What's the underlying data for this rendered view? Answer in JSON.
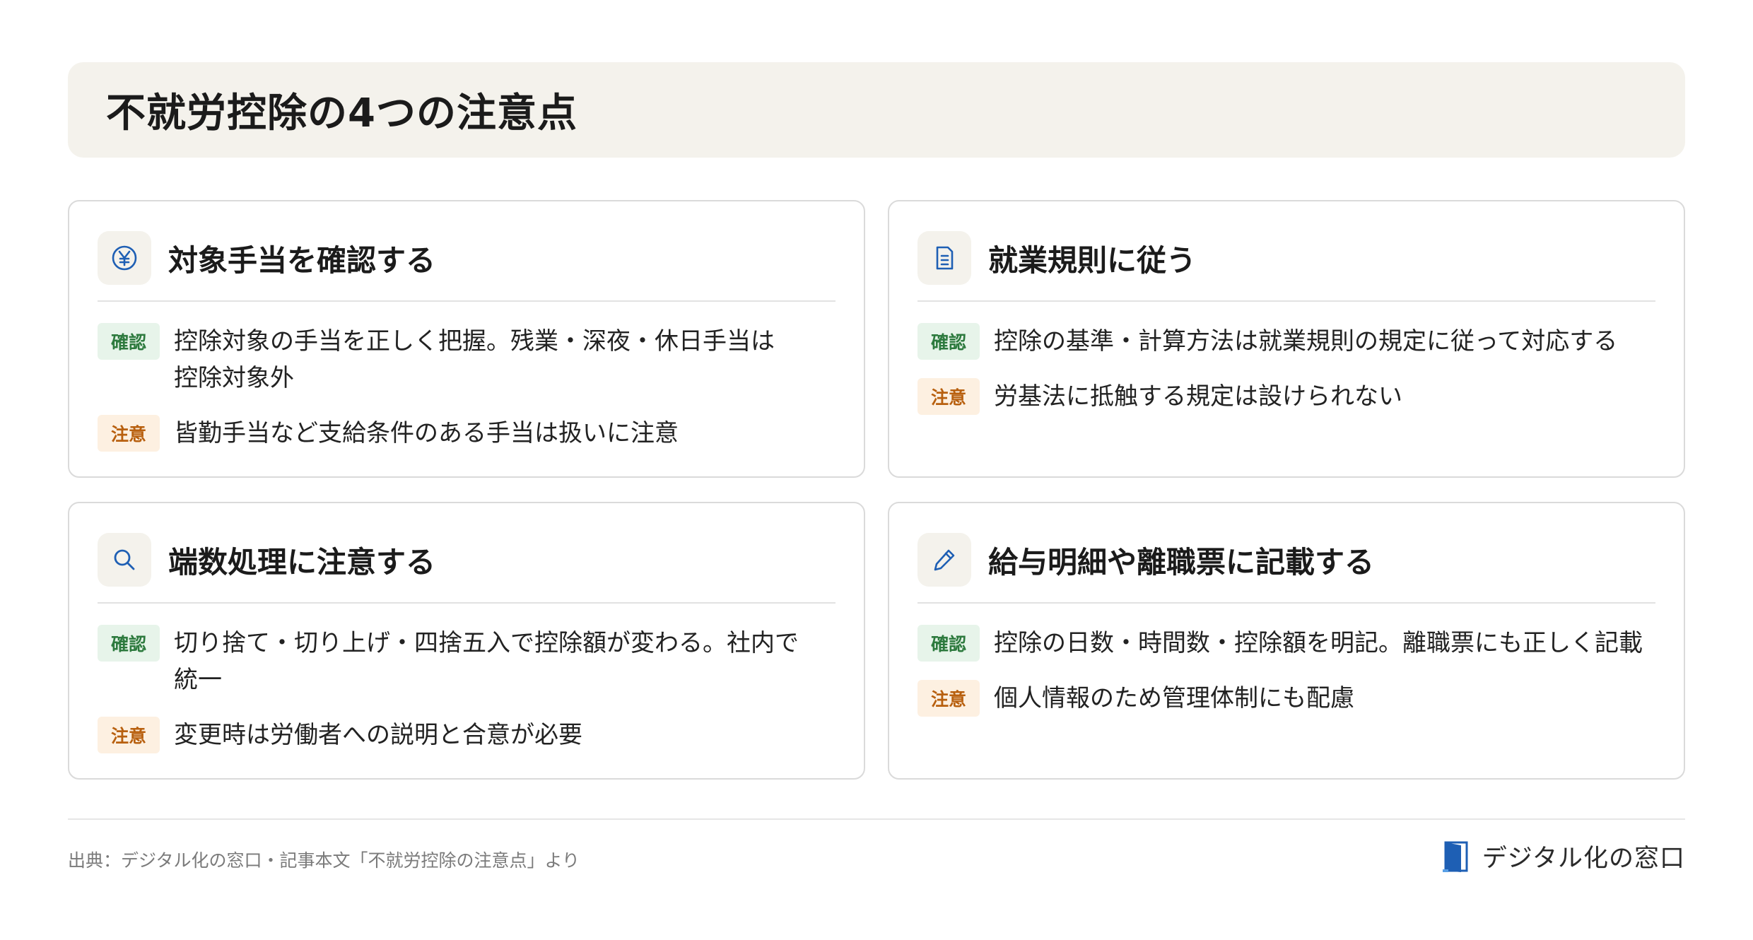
{
  "title": "不就労控除の4つの注意点",
  "labels": {
    "confirm": "確認",
    "caution": "注意"
  },
  "cards": [
    {
      "icon": "yen-circle-icon",
      "title": "対象手当を確認する",
      "confirm": "控除対象の手当を正しく把握。残業・深夜・休日手当は\n控除対象外",
      "caution": "皆勤手当など支給条件のある手当は扱いに注意"
    },
    {
      "icon": "document-icon",
      "title": "就業規則に従う",
      "confirm": "控除の基準・計算方法は就業規則の規定に従って対応する",
      "caution": "労基法に抵触する規定は設けられない"
    },
    {
      "icon": "search-icon",
      "title": "端数処理に注意する",
      "confirm": "切り捨て・切り上げ・四捨五入で控除額が変わる。社内で\n統一",
      "caution": "変更時は労働者への説明と合意が必要"
    },
    {
      "icon": "pencil-icon",
      "title": "給与明細や離職票に記載する",
      "confirm": "控除の日数・時間数・控除額を明記。離職票にも正しく記載",
      "caution": "個人情報のため管理体制にも配慮"
    }
  ],
  "footer": {
    "source": "出典：デジタル化の窓口・記事本文「不就労控除の注意点」より",
    "logo_text": "デジタル化の窓口"
  },
  "colors": {
    "accent_blue": "#1e5fb4",
    "confirm_green": "#2d7a3e",
    "caution_orange": "#b8600f"
  }
}
